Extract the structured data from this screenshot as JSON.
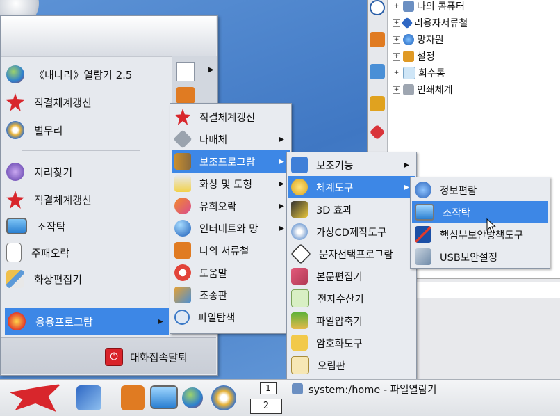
{
  "start_menu": {
    "items": [
      {
        "label": "《내나라》열람기 2.5",
        "icon": "globe-icon"
      },
      {
        "label": "직결체계갱신",
        "icon": "red-star-icon"
      },
      {
        "label": "별무리",
        "icon": "music-disc-icon"
      },
      {
        "label": "지리찾기",
        "icon": "compass-icon"
      },
      {
        "label": "직결체계갱신",
        "icon": "red-star-icon"
      },
      {
        "label": "조작탁",
        "icon": "monitor-icon"
      },
      {
        "label": "주패오락",
        "icon": "cards-icon"
      },
      {
        "label": "화상편집기",
        "icon": "brush-icon"
      },
      {
        "label": "응용프로그람",
        "icon": "apps-icon"
      }
    ],
    "logout_label": "대화접속탈퇴"
  },
  "apps_menu": {
    "items": [
      {
        "label": "직결체계갱신",
        "arrow": false
      },
      {
        "label": "다매체",
        "arrow": true
      },
      {
        "label": "보조프로그람",
        "arrow": true
      },
      {
        "label": "화상 및 도형",
        "arrow": true
      },
      {
        "label": "유희오락",
        "arrow": true
      },
      {
        "label": "인터네트와 망",
        "arrow": true
      },
      {
        "label": "나의 서류철",
        "arrow": false
      },
      {
        "label": "도움말",
        "arrow": false
      },
      {
        "label": "조종판",
        "arrow": false
      },
      {
        "label": "파일탐색",
        "arrow": false
      }
    ]
  },
  "accessories_menu": {
    "items": [
      {
        "label": "보조기능",
        "arrow": true
      },
      {
        "label": "체계도구",
        "arrow": true
      },
      {
        "label": "3D 효과",
        "arrow": false
      },
      {
        "label": "가상CD제작도구",
        "arrow": false
      },
      {
        "label": "문자선택프로그람",
        "arrow": false
      },
      {
        "label": "본문편집기",
        "arrow": false
      },
      {
        "label": "전자수산기",
        "arrow": false
      },
      {
        "label": "파일압축기",
        "arrow": false
      },
      {
        "label": "암호화도구",
        "arrow": false
      },
      {
        "label": "오림판",
        "arrow": false
      }
    ]
  },
  "system_tools_menu": {
    "items": [
      {
        "label": "정보편람"
      },
      {
        "label": "조작탁"
      },
      {
        "label": "핵심부보안방책도구"
      },
      {
        "label": "USB보안설정"
      }
    ]
  },
  "file_manager": {
    "tree": [
      {
        "label": "나의 콤퓨터"
      },
      {
        "label": "리용자서류철"
      },
      {
        "label": "망자원"
      },
      {
        "label": "설정"
      },
      {
        "label": "회수통"
      },
      {
        "label": "인쇄체계"
      }
    ]
  },
  "taskbar": {
    "workspace_1": "1",
    "workspace_2": "2",
    "task_label": "system:/home - 파일열람기"
  },
  "colors": {
    "selection": "#3d87e6",
    "menu_bg": "#e8ebf0",
    "desktop": "#4a7fc9"
  }
}
